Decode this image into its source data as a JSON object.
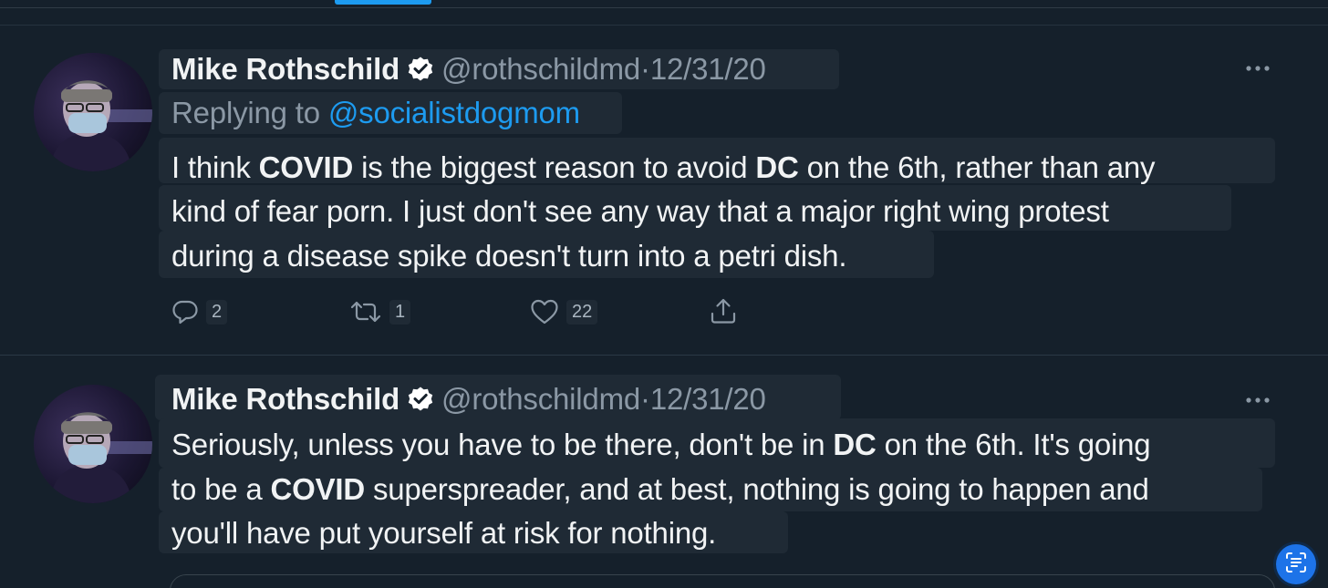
{
  "tweets": [
    {
      "author_name": "Mike Rothschild",
      "handle": "@rothschildmd",
      "separator": "·",
      "date": "12/31/20",
      "replying_to_prefix": "Replying to ",
      "replying_to_handle": "@socialistdogmom",
      "lines": [
        [
          "I think ",
          "COVID",
          " is the biggest reason to avoid ",
          "DC",
          " on the 6th, rather than any"
        ],
        [
          "kind of fear porn. I just don't see any way that a major right wing protest"
        ],
        [
          "during a disease spike doesn't turn into a petri dish."
        ]
      ],
      "actions": {
        "reply_count": "2",
        "retweet_count": "1",
        "like_count": "22"
      }
    },
    {
      "author_name": "Mike Rothschild",
      "handle": "@rothschildmd",
      "separator": "·",
      "date": "12/31/20",
      "lines": [
        [
          "Seriously, unless you have to be there, don't be in ",
          "DC",
          " on the 6th. It's going"
        ],
        [
          "to be a ",
          "COVID",
          " superspreader, and at best, nothing is going to happen and"
        ],
        [
          "you'll have put yourself at risk for nothing."
        ]
      ]
    }
  ],
  "icons": {
    "verified": "verified-badge-icon",
    "more": "more-options-icon",
    "reply": "reply-icon",
    "retweet": "retweet-icon",
    "like": "like-icon",
    "share": "share-icon",
    "lens": "text-recognition-icon"
  },
  "colors": {
    "background": "#15202b",
    "accent": "#1d9bf0",
    "muted": "#8b98a5",
    "text": "#f1f3f4"
  }
}
